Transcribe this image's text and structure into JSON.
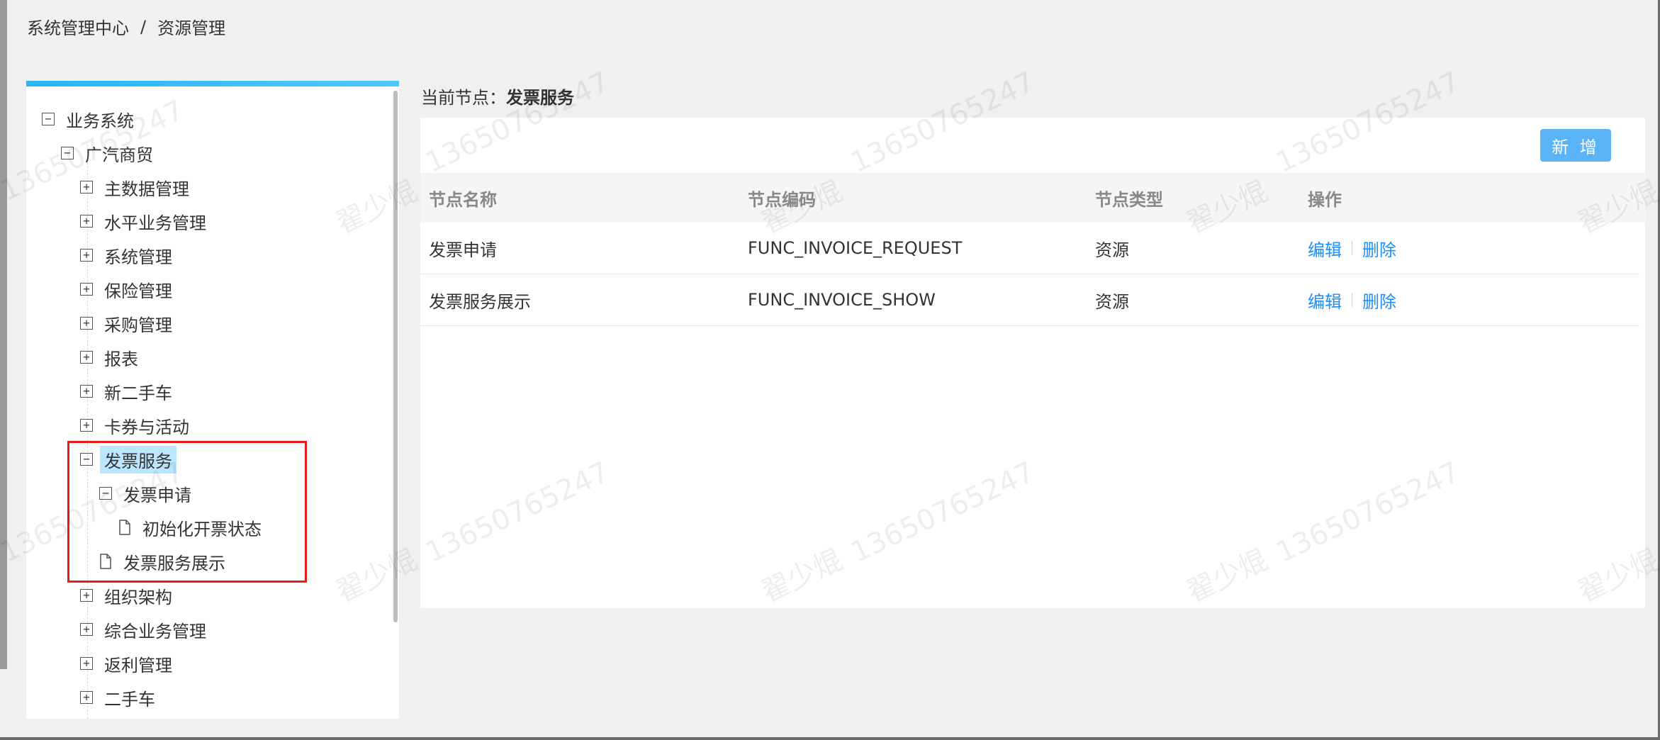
{
  "breadcrumb": {
    "items": [
      "系统管理中心",
      "资源管理"
    ],
    "separator": "/"
  },
  "tree": {
    "nodes": [
      {
        "label": "业务系统",
        "expanded": true
      },
      {
        "label": "广汽商贸",
        "expanded": true
      },
      {
        "label": "主数据管理",
        "expanded": false
      },
      {
        "label": "水平业务管理",
        "expanded": false
      },
      {
        "label": "系统管理",
        "expanded": false
      },
      {
        "label": "保险管理",
        "expanded": false
      },
      {
        "label": "采购管理",
        "expanded": false
      },
      {
        "label": "报表",
        "expanded": false
      },
      {
        "label": "新二手车",
        "expanded": false
      },
      {
        "label": "卡券与活动",
        "expanded": false
      },
      {
        "label": "发票服务",
        "expanded": true,
        "selected": true
      },
      {
        "label": "发票申请",
        "expanded": true
      },
      {
        "label": "初始化开票状态",
        "leaf": true
      },
      {
        "label": "发票服务展示",
        "leaf": true
      },
      {
        "label": "组织架构",
        "expanded": false
      },
      {
        "label": "综合业务管理",
        "expanded": false
      },
      {
        "label": "返利管理",
        "expanded": false
      },
      {
        "label": "二手车",
        "expanded": false
      }
    ]
  },
  "current_node": {
    "label": "当前节点：",
    "value": "发票服务"
  },
  "toolbar": {
    "add_label": "新 增"
  },
  "table": {
    "headers": [
      "节点名称",
      "节点编码",
      "节点类型",
      "操作"
    ],
    "rows": [
      {
        "name": "发票申请",
        "code": "FUNC_INVOICE_REQUEST",
        "type": "资源",
        "edit": "编辑",
        "delete": "删除"
      },
      {
        "name": "发票服务展示",
        "code": "FUNC_INVOICE_SHOW",
        "type": "资源",
        "edit": "编辑",
        "delete": "删除"
      }
    ]
  },
  "watermark": {
    "name": "翟少焜",
    "number": "13650765247"
  },
  "colors": {
    "accent": "#1890ff",
    "add_button": "#5ab3f5",
    "selected_bg": "#bae7ff",
    "highlight_border": "#e51c1c",
    "topbar": "#28b6f6"
  },
  "icons": {
    "collapse": "minus-square-icon",
    "expand": "plus-square-icon",
    "leaf": "file-icon"
  }
}
